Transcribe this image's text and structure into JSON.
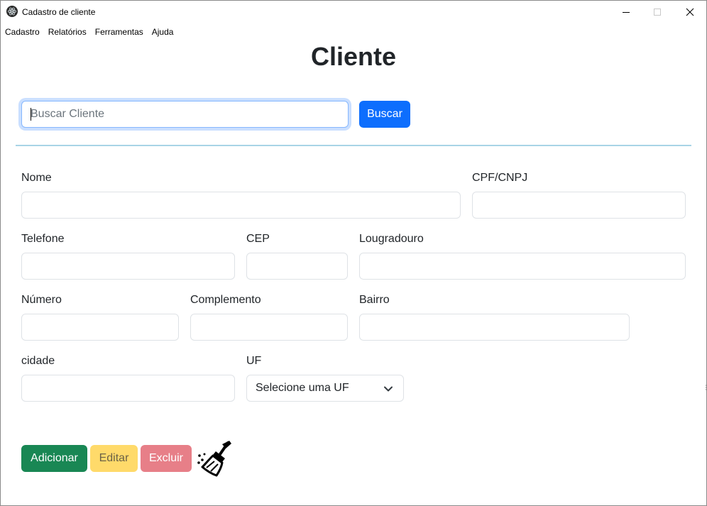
{
  "window": {
    "title": "Cadastro de cliente",
    "icons": {
      "app": "electron-atom-icon",
      "minimize": "minimize-icon",
      "maximize": "maximize-icon",
      "close": "close-icon"
    }
  },
  "menu": {
    "items": [
      "Cadastro",
      "Relatórios",
      "Ferramentas",
      "Ajuda"
    ]
  },
  "page": {
    "title": "Cliente"
  },
  "search": {
    "placeholder": "Buscar Cliente",
    "value": "",
    "button_label": "Buscar"
  },
  "form": {
    "nome": {
      "label": "Nome",
      "value": ""
    },
    "cpf_cnpj": {
      "label": "CPF/CNPJ",
      "value": ""
    },
    "telefone": {
      "label": "Telefone",
      "value": ""
    },
    "cep": {
      "label": "CEP",
      "value": ""
    },
    "logradouro": {
      "label": "Lougradouro",
      "value": ""
    },
    "numero": {
      "label": "Número",
      "value": ""
    },
    "complemento": {
      "label": "Complemento",
      "value": ""
    },
    "bairro": {
      "label": "Bairro",
      "value": ""
    },
    "cidade": {
      "label": "cidade",
      "value": ""
    },
    "uf": {
      "label": "UF",
      "selected": "Selecione uma UF"
    }
  },
  "actions": {
    "add_label": "Adicionar",
    "edit_label": "Editar",
    "delete_label": "Excluir",
    "clear_icon": "broom-icon"
  },
  "colors": {
    "primary": "#0d6efd",
    "success": "#198754",
    "warning": "#ffda6a",
    "danger": "#e77f88",
    "divider": "#a8d4e6"
  }
}
